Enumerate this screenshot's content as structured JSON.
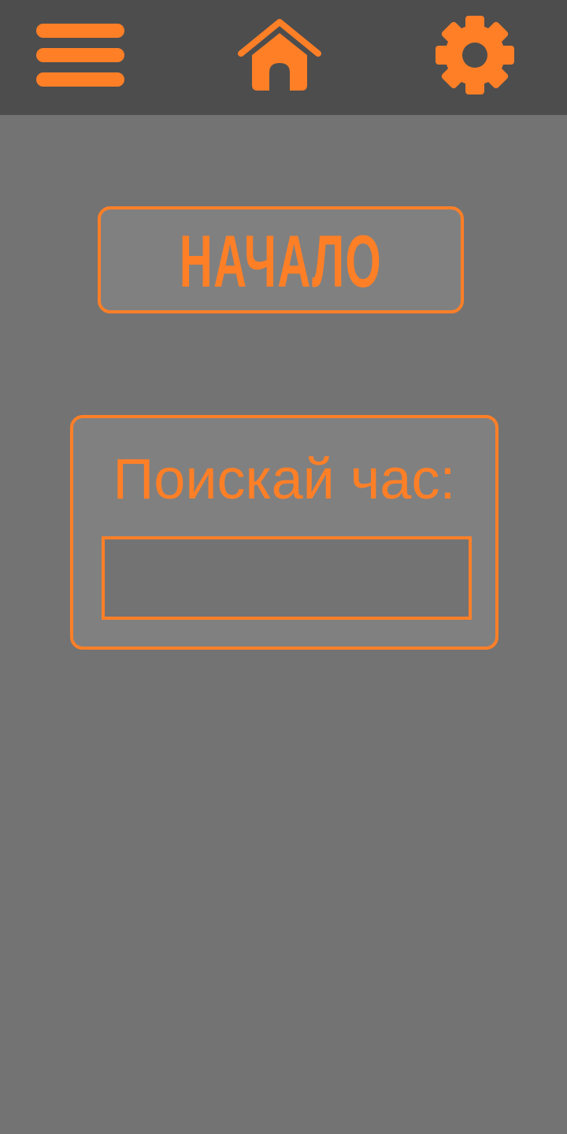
{
  "colors": {
    "accent": "#ff7f27",
    "topbar_bg": "#4d4d4d",
    "page_bg": "#737373",
    "panel_bg": "#808080"
  },
  "topbar": {
    "icons": [
      "menu-icon",
      "home-icon",
      "gear-icon"
    ]
  },
  "start_button": {
    "label": "НАЧАЛО"
  },
  "search": {
    "label": "Поискай час:",
    "value": "",
    "placeholder": ""
  }
}
